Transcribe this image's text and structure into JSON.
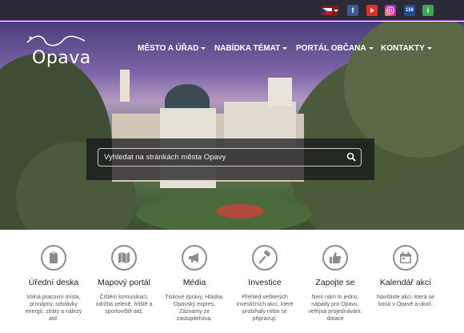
{
  "topbar": {
    "language": "cs",
    "social": [
      "facebook-icon",
      "youtube-icon",
      "instagram-icon",
      "phone-156-icon",
      "info-icon"
    ],
    "phone_label": "156",
    "info_label": "i",
    "colors": {
      "background": "#2d2a37",
      "accent": "#8a3bb7"
    }
  },
  "header": {
    "logo_text": "Opava",
    "nav": [
      {
        "label": "MĚSTO A ÚŘAD"
      },
      {
        "label": "NABÍDKA TÉMAT"
      },
      {
        "label": "PORTÁL OBČANA"
      },
      {
        "label": "KONTAKTY"
      }
    ]
  },
  "search": {
    "placeholder": "Vyhledat na stránkách města Opavy"
  },
  "services": [
    {
      "icon": "clipboard-icon",
      "title": "Úřední deska",
      "description": "Volná pracovní místa, pronájmy, odstávky energií, ztráty a nálezy atd."
    },
    {
      "icon": "map-icon",
      "title": "Mapový portál",
      "description": "Čištění komunikací, údržba zeleně, hřiště a sportoviště atd."
    },
    {
      "icon": "megaphone-icon",
      "title": "Média",
      "description": "Tiskové zprávy, Hláska, Opavský expres, Záznamy ze zastupitelstva."
    },
    {
      "icon": "hammer-icon",
      "title": "Investice",
      "description": "Přehled veškerých investičních akcí, které probíhaly nebo se připravují."
    },
    {
      "icon": "thumbs-up-icon",
      "title": "Zapojte se",
      "description": "Není nám to jedno, nápady pro Opavu, veřejná projednávání, dotace"
    },
    {
      "icon": "calendar-icon",
      "title": "Kalendář akcí",
      "description": "Navštivte akci, která se koná v Opavě a okolí."
    }
  ]
}
